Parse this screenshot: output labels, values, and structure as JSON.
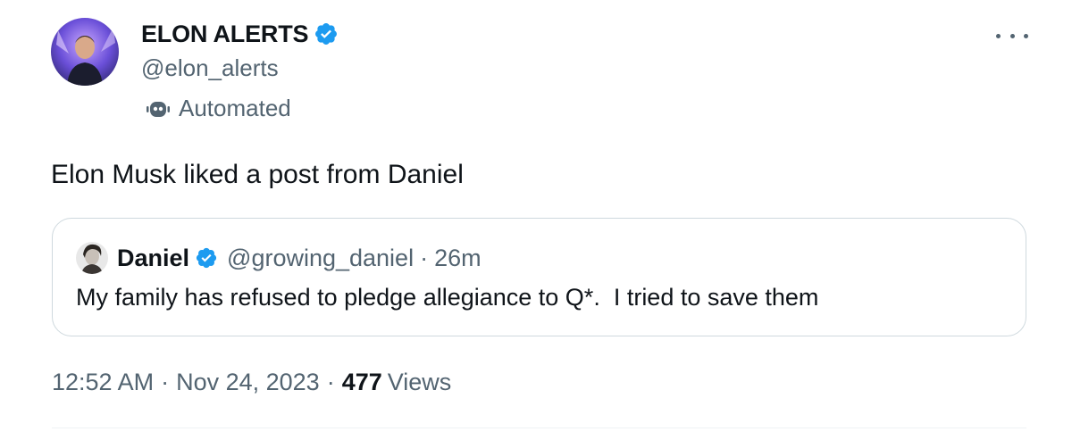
{
  "author": {
    "display_name": "ELON ALERTS",
    "handle": "@elon_alerts",
    "automated_label": "Automated",
    "avatar_icon": "profile-photo-avatar",
    "verified_icon": "verified-badge-icon",
    "more_icon": "more-options-icon"
  },
  "tweet": {
    "text": "Elon Musk liked a post from Daniel"
  },
  "quoted": {
    "name": "Daniel",
    "handle": "@growing_daniel",
    "separator": "·",
    "time": "26m",
    "text": "My family has refused to pledge allegiance to Q*.  I tried to save them"
  },
  "meta": {
    "time": "12:52 AM",
    "separator": "·",
    "date": "Nov 24, 2023",
    "views_count": "477",
    "views_label": "Views"
  },
  "colors": {
    "text_primary": "#0f1419",
    "text_secondary": "#536471",
    "verified_blue": "#1d9bf0",
    "border": "#cfd9de"
  }
}
